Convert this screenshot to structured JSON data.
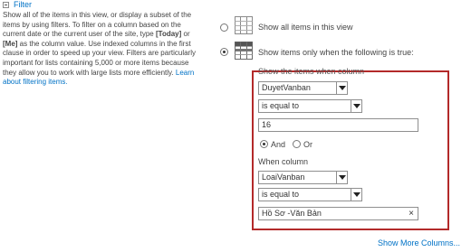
{
  "section": {
    "title": "Filter"
  },
  "description": {
    "part1": "Show all of the items in this view, or display a subset of the items by using filters. To filter on a column based on the current date or the current user of the site, type ",
    "today": "[Today]",
    "part2": " or ",
    "me": "[Me]",
    "part3": " as the column value. Use indexed columns in the first clause in order to speed up your view. Filters are particularly important for lists containing 5,000 or more items because they allow you to work with large lists more efficiently. ",
    "link": "Learn about filtering items."
  },
  "options": {
    "all_label": "Show all items in this view",
    "some_label": "Show items only when the following is true:"
  },
  "filter": {
    "header_partial": "Show the items when column",
    "column1": "DuyetVanban",
    "operator1": "is equal to",
    "value1": "16",
    "and_label": "And",
    "or_label": "Or",
    "when_column_label": "When column",
    "column2": "LoaiVanban",
    "operator2": "is equal to",
    "value2": "Hồ Sơ -Văn Bản",
    "clear_glyph": "×"
  },
  "more_columns": "Show More Columns..."
}
